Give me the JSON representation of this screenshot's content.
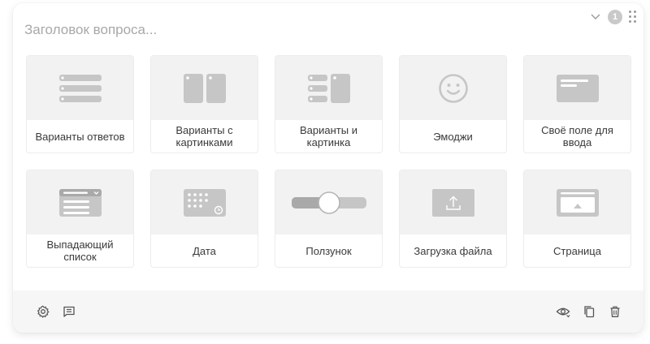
{
  "question": {
    "title_placeholder": "Заголовок вопроса...",
    "title_value": ""
  },
  "header": {
    "badge_count": "1",
    "icons": [
      "chevron-down-icon",
      "drag-handle-icon"
    ]
  },
  "types": [
    {
      "id": "variants",
      "label": "Варианты ответов",
      "icon": "list-icon"
    },
    {
      "id": "image-variants",
      "label": "Варианты с картинками",
      "icon": "image-cards-icon"
    },
    {
      "id": "variants-image",
      "label": "Варианты и картинка",
      "icon": "list-with-image-icon"
    },
    {
      "id": "emoji",
      "label": "Эмоджи",
      "icon": "smiley-icon"
    },
    {
      "id": "text-field",
      "label": "Своё поле для ввода",
      "icon": "text-field-icon"
    },
    {
      "id": "dropdown",
      "label": "Выпадающий список",
      "icon": "dropdown-icon"
    },
    {
      "id": "date",
      "label": "Дата",
      "icon": "calendar-icon"
    },
    {
      "id": "slider",
      "label": "Ползунок",
      "icon": "slider-icon"
    },
    {
      "id": "file-upload",
      "label": "Загрузка файла",
      "icon": "upload-icon"
    },
    {
      "id": "page",
      "label": "Страница",
      "icon": "page-icon"
    }
  ],
  "footer": {
    "left_icons": [
      "settings-icon",
      "comment-icon"
    ],
    "right_icons": [
      "eye-icon",
      "copy-icon",
      "trash-icon"
    ]
  },
  "colors": {
    "icon_gray": "#c6c6c6",
    "tile_bg": "#f2f2f2",
    "footer_bg": "#f6f6f6",
    "text": "#3a3a3a",
    "placeholder": "#a8a8a8"
  }
}
